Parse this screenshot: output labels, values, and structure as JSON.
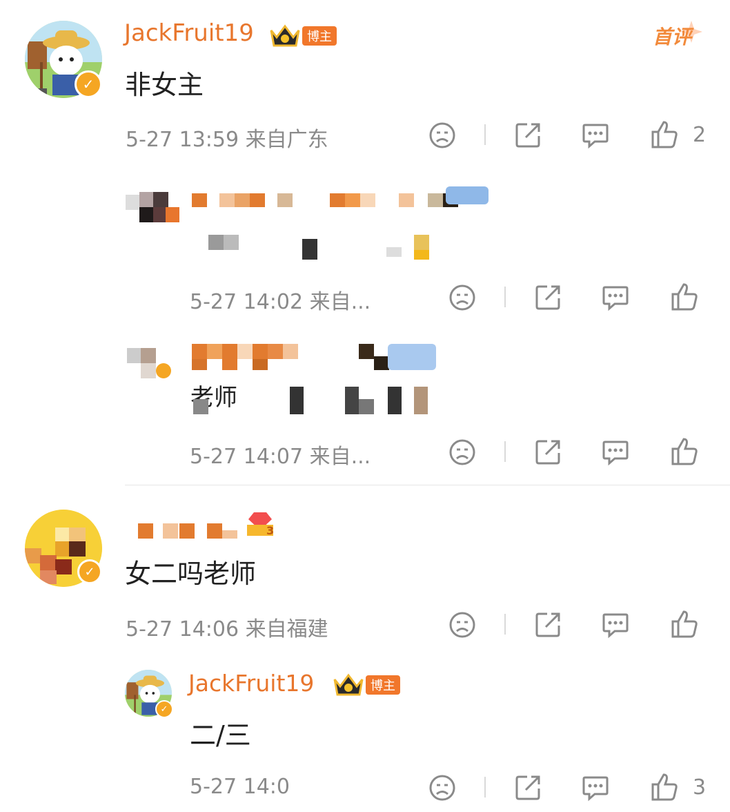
{
  "comments": [
    {
      "username": "JackFruit19",
      "tag": "博主",
      "first_label": "首评",
      "text": "非女主",
      "meta": "5-27 13:59 来自广东",
      "likes": "2",
      "replies": [
        {
          "meta": "5-27 14:02 来自..."
        },
        {
          "text_visible": "老师",
          "meta": "5-27 14:07 来自..."
        }
      ]
    },
    {
      "level_badge": "3",
      "text": "女二吗老师",
      "meta": "5-27 14:06 来自福建",
      "replies": [
        {
          "username": "JackFruit19",
          "tag": "博主",
          "text": "二/三",
          "meta": "5-27 14:0",
          "likes": "3"
        }
      ]
    }
  ],
  "colors": {
    "username": "#e8762d",
    "tag_bg": "#f1772b",
    "meta": "#8a8a8a",
    "icon": "#8a8a8a"
  },
  "icons": [
    "dislike-icon",
    "share-icon",
    "comment-icon",
    "like-icon",
    "verified-badge-icon",
    "crown-icon",
    "level-badge-icon"
  ]
}
